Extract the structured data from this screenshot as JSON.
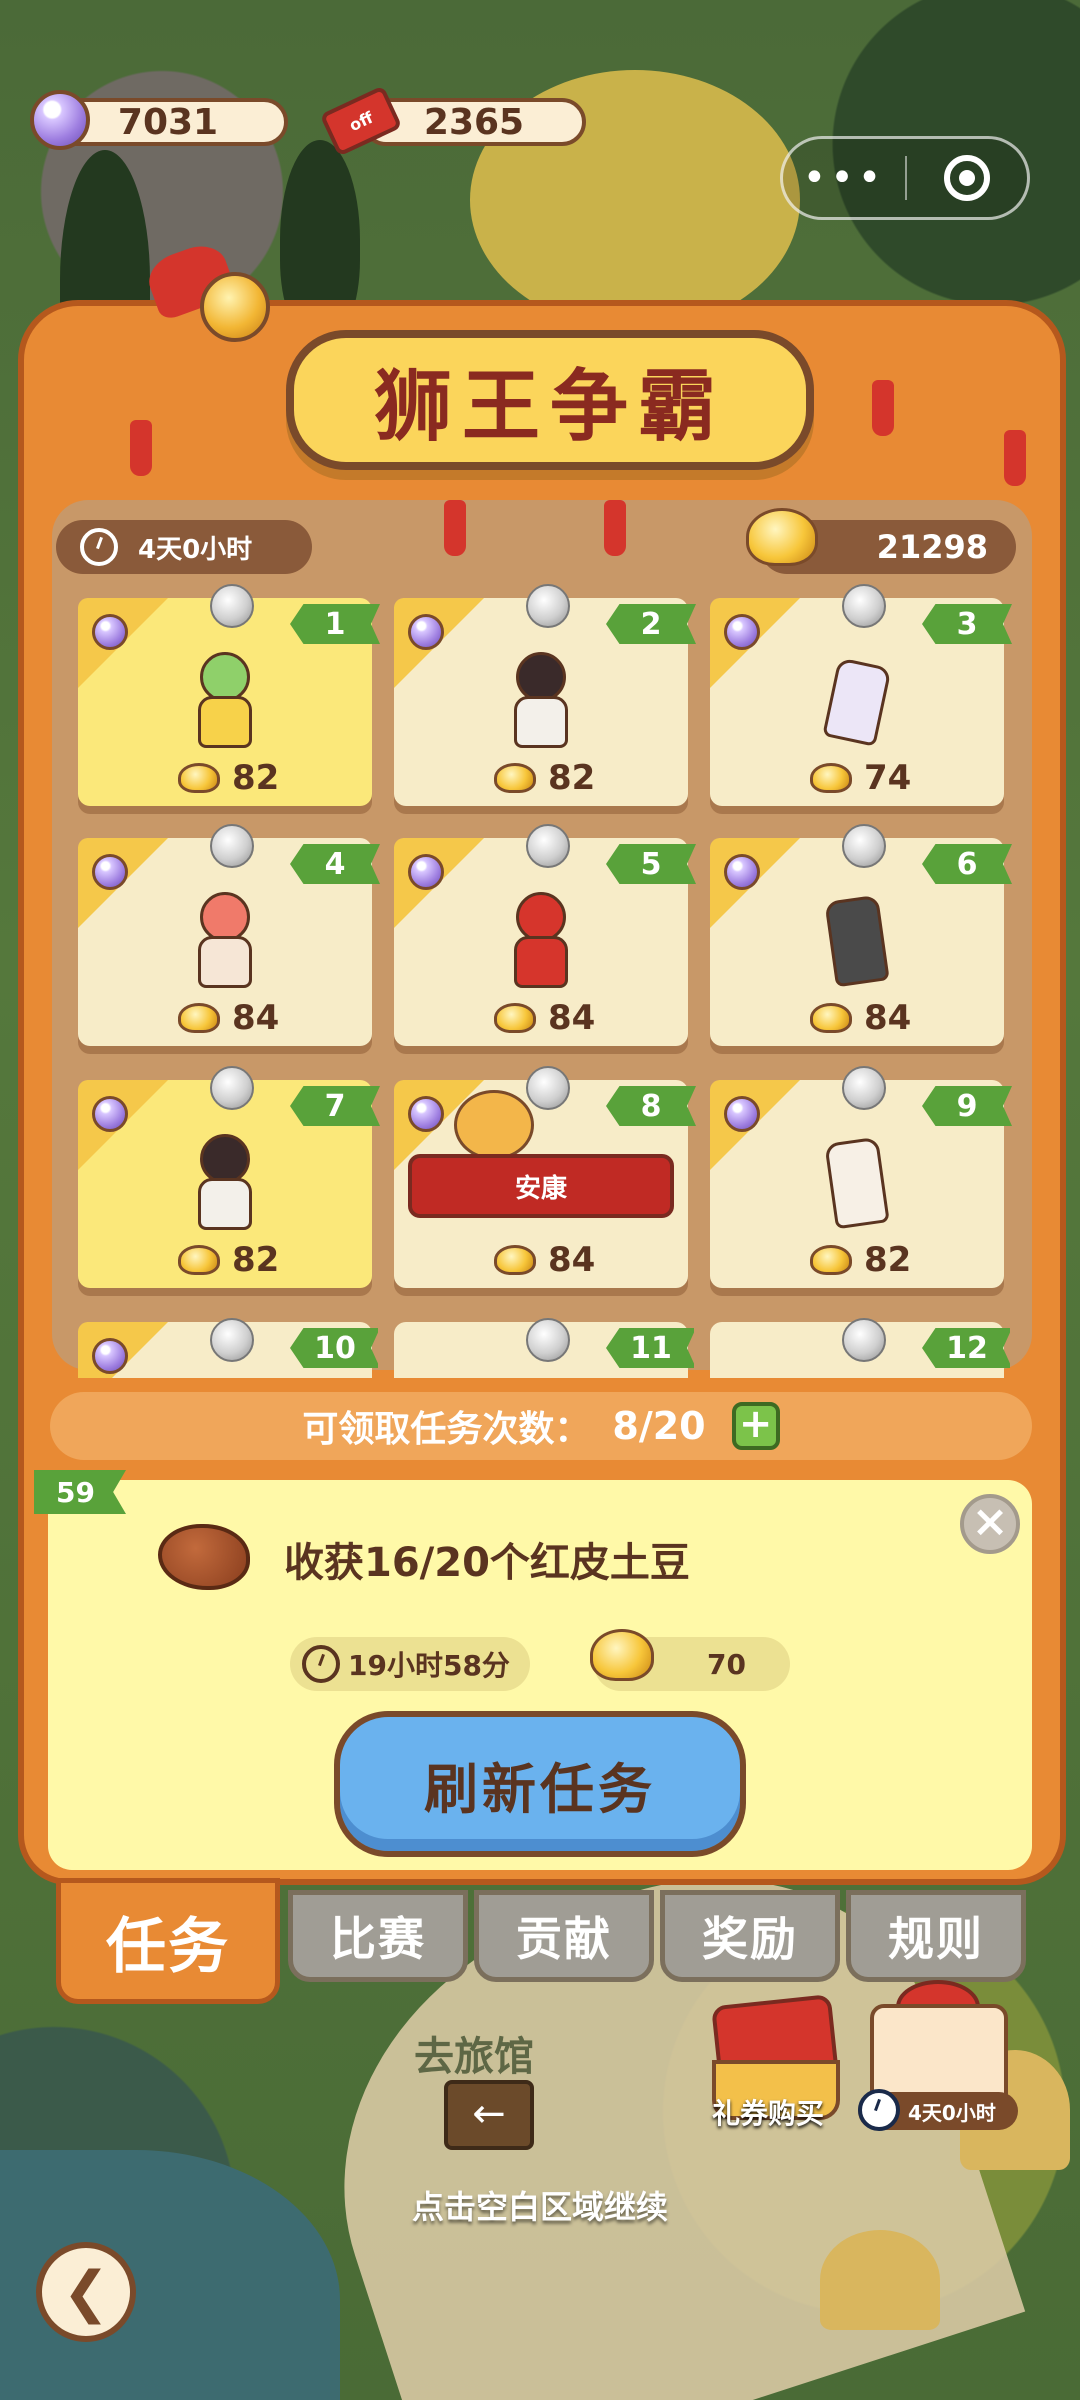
{
  "currencies": {
    "pearls": "7031",
    "coupons": "2365",
    "coupon_icon_text": "off"
  },
  "capsule": {
    "more": "•••"
  },
  "event": {
    "title": "狮王争霸",
    "time_left": "4天0小时",
    "score": "21298"
  },
  "cards": [
    {
      "index": "1",
      "reward": "82",
      "highlighted": true,
      "figure_color": "#8fd06a"
    },
    {
      "index": "2",
      "reward": "82",
      "highlighted": false,
      "figure_color": "#f3f0ea"
    },
    {
      "index": "3",
      "reward": "74",
      "highlighted": false,
      "figure_color": "#ece6f7"
    },
    {
      "index": "4",
      "reward": "84",
      "highlighted": false,
      "figure_color": "#f07a6a"
    },
    {
      "index": "5",
      "reward": "84",
      "highlighted": false,
      "figure_color": "#d6352c"
    },
    {
      "index": "6",
      "reward": "84",
      "highlighted": false,
      "figure_color": "#4a4a4a"
    },
    {
      "index": "7",
      "reward": "82",
      "highlighted": true,
      "figure_color": "#f3f0ea"
    },
    {
      "index": "8",
      "reward": "84",
      "highlighted": false,
      "claimed_label": "安康"
    },
    {
      "index": "9",
      "reward": "82",
      "highlighted": false,
      "figure_color": "#f7f0e6"
    },
    {
      "index": "10"
    },
    {
      "index": "11"
    },
    {
      "index": "12"
    }
  ],
  "task_count": {
    "label": "可领取任务次数：",
    "value": "8/20",
    "plus": "+"
  },
  "current_task": {
    "level": "59",
    "description": "收获16/20个红皮土豆",
    "time_left": "19小时58分",
    "reward": "70",
    "refresh_label": "刷新任务",
    "close": "×"
  },
  "tabs": [
    {
      "label": "任务",
      "active": true
    },
    {
      "label": "比赛",
      "active": false
    },
    {
      "label": "贡献",
      "active": false
    },
    {
      "label": "奖励",
      "active": false
    },
    {
      "label": "规则",
      "active": false
    }
  ],
  "world": {
    "inn_label": "去旅馆",
    "sign_arrow": "←",
    "continue_hint": "点击空白区域继续",
    "shop_label": "礼券购买",
    "gift_timer": "4天0小时",
    "back_arrow": "❮"
  },
  "colors": {
    "panel": "#e88a34",
    "title_text": "#8a2a20",
    "number_tag": "#59a23a",
    "refresh_button": "#6ab2ee"
  }
}
